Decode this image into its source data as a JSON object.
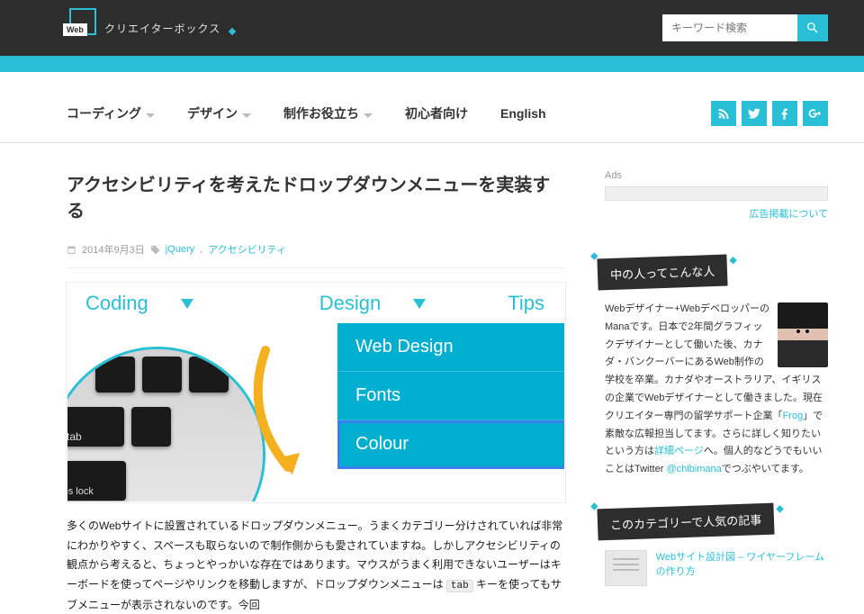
{
  "header": {
    "logo_text": "クリエイターボックス",
    "search_placeholder": "キーワード検索"
  },
  "nav": {
    "items": [
      "コーディング",
      "デザイン",
      "制作お役立ち",
      "初心者向け",
      "English"
    ]
  },
  "article": {
    "title": "アクセシビリティを考えたドロップダウンメニューを実装する",
    "date": "2014年9月3日",
    "tags": [
      "jQuery",
      "アクセシビリティ"
    ],
    "hero_menu": {
      "coding": "Coding",
      "design": "Design",
      "tips": "Tips"
    },
    "hero_dropdown": [
      "Web Design",
      "Fonts",
      "Colour"
    ],
    "keys": {
      "tab": "tab",
      "caps": "caps lock"
    },
    "body_1": "多くのWebサイトに設置されているドロップダウンメニュー。うまくカテゴリー分けされていれば非常にわかりやすく、スペースも取らないので制作側からも愛されていますね。しかしアクセシビリティの観点から考えると、ちょっとやっかいな存在ではあります。マウスがうまく利用できないユーザーはキーボードを使ってページやリンクを移動しますが、ドロップダウンメニューは ",
    "code": "tab",
    "body_2": " キーを使ってもサブメニューが表示されないのです。今回"
  },
  "sidebar": {
    "ads_label": "Ads",
    "ads_link": "広告掲載について",
    "about_title": "中の人ってこんな人",
    "about_1": "Webデザイナー+WebデベロッパーのManaです。日本で2年間グラフィックデザイナーとして働いた後、カナダ・バンクーバーにあるWeb制作の学校を卒業。カナダやオーストラリア、イギリスの企業でWebデザイナーとして働きました。現在クリエイター専門の留学サポート企業「",
    "frog": "Frog",
    "about_2": "」で素敵な広報担当してます。さらに詳しく知りたいという方は",
    "detail": "詳細ページ",
    "about_3": "へ。個人的などうでもいいことはTwitter ",
    "twitter": "@chibimana",
    "about_4": "でつぶやいてます。",
    "popular_title": "このカテゴリーで人気の記事",
    "popular_link": "Webサイト設計図 – ワイヤーフレームの作り方"
  }
}
